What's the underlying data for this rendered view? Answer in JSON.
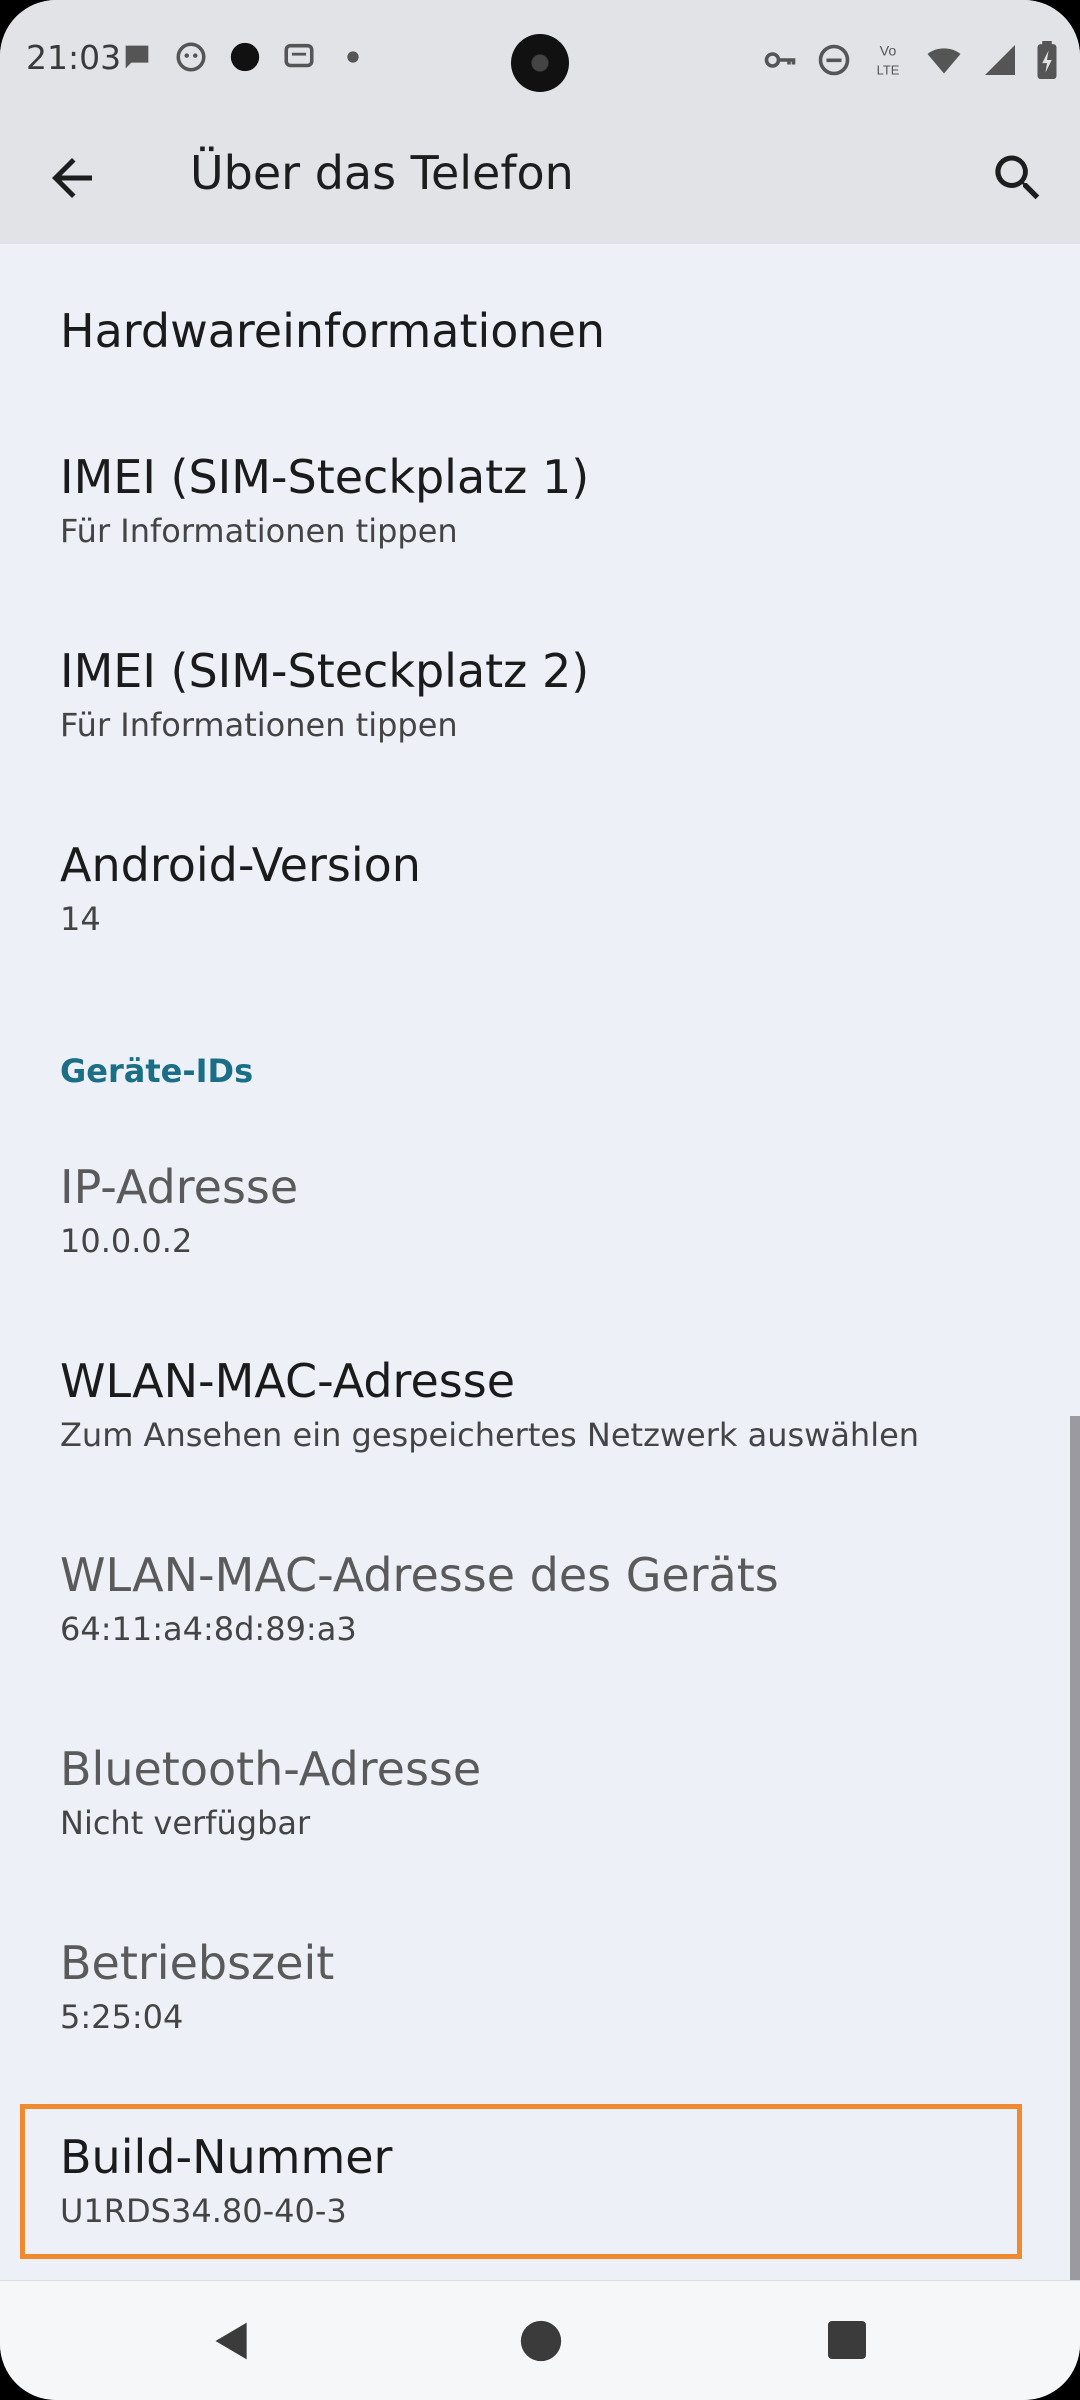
{
  "status_bar": {
    "time": "21:03",
    "left_icons": [
      "chat-bubble-icon",
      "smiley-icon",
      "dot-icon",
      "message-icon",
      "small-dot-icon"
    ],
    "right_icons": [
      "vpn-key-icon",
      "do-not-disturb-icon",
      "volte-icon",
      "wifi-icon",
      "signal-icon",
      "battery-icon"
    ],
    "volte_label_top": "Vo",
    "volte_label_bottom": "LTE"
  },
  "app_bar": {
    "title": "Über das Telefon"
  },
  "items": [
    {
      "title": "Hardwareinformationen",
      "subtitle": ""
    },
    {
      "title": "IMEI (SIM-Steckplatz 1)",
      "subtitle": "Für Informationen tippen"
    },
    {
      "title": "IMEI (SIM-Steckplatz 2)",
      "subtitle": "Für Informationen tippen"
    },
    {
      "title": "Android-Version",
      "subtitle": "14"
    }
  ],
  "section": {
    "header": "Geräte-IDs",
    "items": [
      {
        "title": "IP-Adresse",
        "subtitle": "10.0.0.2"
      },
      {
        "title": "WLAN-MAC-Adresse",
        "subtitle": "Zum Ansehen ein gespeichertes Netzwerk auswählen"
      },
      {
        "title": "WLAN-MAC-Adresse des Geräts",
        "subtitle": "64:11:a4:8d:89:a3"
      },
      {
        "title": "Bluetooth-Adresse",
        "subtitle": "Nicht verfügbar"
      },
      {
        "title": "Betriebszeit",
        "subtitle": "5:25:04"
      },
      {
        "title": "Build-Nummer",
        "subtitle": "U1RDS34.80-40-3"
      }
    ]
  },
  "colors": {
    "accent": "#1a6e86",
    "highlight": "#f08a2e",
    "app_bar_bg": "#e1e3e6",
    "content_bg": "#edf0f7"
  }
}
